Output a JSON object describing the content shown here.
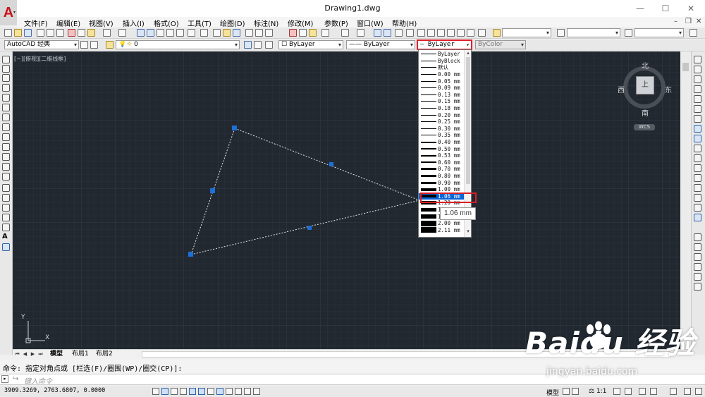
{
  "window": {
    "title": "Drawing1.dwg",
    "app_logo": "A"
  },
  "menu": [
    "文件(F)",
    "编辑(E)",
    "视图(V)",
    "插入(I)",
    "格式(O)",
    "工具(T)",
    "绘图(D)",
    "标注(N)",
    "修改(M)",
    "参数(P)",
    "窗口(W)",
    "帮助(H)"
  ],
  "toolbar": {
    "workspace": "AutoCAD 经典",
    "layer": "0",
    "color_layer": "ByLayer",
    "linetype": "ByLayer",
    "lineweight": "ByLayer",
    "plotstyle": "ByColor"
  },
  "viewport": {
    "label": "[−][俯视][二维线框]"
  },
  "compass": {
    "north": "北",
    "south": "南",
    "west": "西",
    "east": "东",
    "top": "上",
    "wcs": "WCS"
  },
  "ucs": {
    "y": "Y",
    "x": "X"
  },
  "lineweight_dropdown": {
    "items": [
      "ByLayer",
      "ByBlock",
      "默认",
      "0.00 mm",
      "0.05 mm",
      "0.09 mm",
      "0.13 mm",
      "0.15 mm",
      "0.18 mm",
      "0.20 mm",
      "0.25 mm",
      "0.30 mm",
      "0.35 mm",
      "0.40 mm",
      "0.50 mm",
      "0.53 mm",
      "0.60 mm",
      "0.70 mm",
      "0.80 mm",
      "0.90 mm",
      "1.00 mm",
      "1.06 mm",
      "1.20 mm",
      "1.40 mm",
      "1.58 mm",
      "2.00 mm",
      "2.11 mm"
    ],
    "selected": "1.06 mm",
    "tooltip": "1.06 mm"
  },
  "layout_tabs": [
    "模型",
    "布局1",
    "布局2"
  ],
  "command": {
    "history": "命令: 指定对角点或 [栏选(F)/圈围(WP)/圈交(CP)]:",
    "placeholder": "键入命令"
  },
  "status": {
    "coordinates": "3909.3269, 2763.6807, 0.0000",
    "model": "模型",
    "scale": "1:1"
  },
  "watermark": {
    "brand": "Baidu 经验",
    "url": "jingyan.baidu.com"
  },
  "colors": {
    "canvas": "#212830",
    "grip": "#1e6fd8",
    "highlight": "#d81f26",
    "selection": "#0a64d8"
  }
}
